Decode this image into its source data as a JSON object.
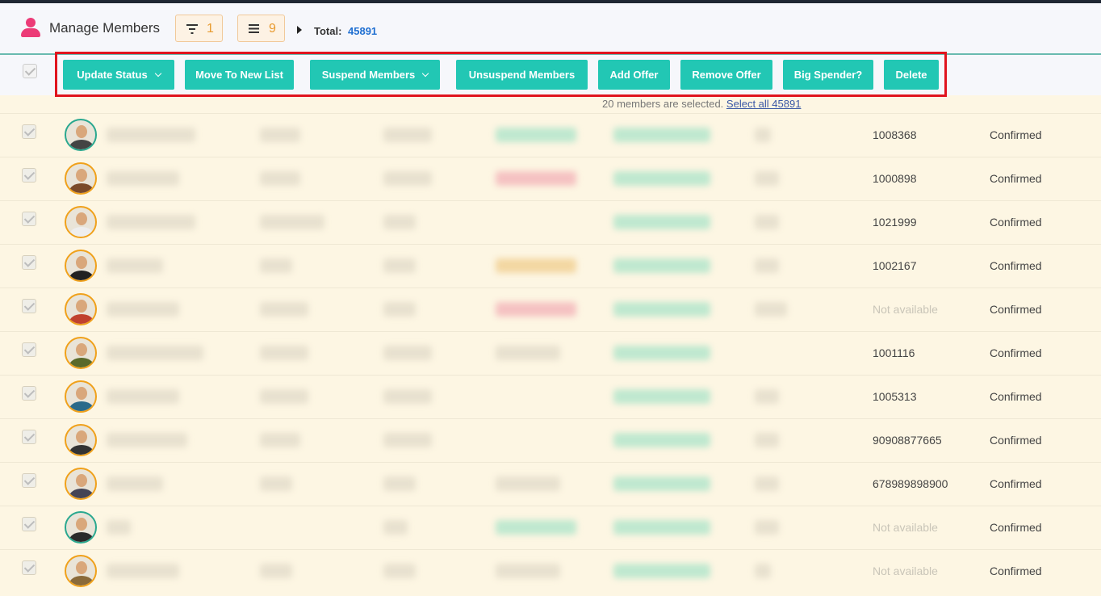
{
  "header": {
    "title": "Manage Members",
    "filter_count": "1",
    "list_count": "9",
    "total_label": "Total:",
    "total_value": "45891"
  },
  "actions": {
    "update_status": "Update Status",
    "move_to_new_list": "Move To New List",
    "suspend_members": "Suspend Members",
    "unsuspend_members": "Unsuspend Members",
    "add_offer": "Add Offer",
    "remove_offer": "Remove Offer",
    "big_spender": "Big Spender?",
    "delete": "Delete"
  },
  "selection": {
    "note": "20 members are selected.",
    "select_all": "Select all 45891"
  },
  "rows": [
    {
      "id": "1008368",
      "status": "Confirmed"
    },
    {
      "id": "1000898",
      "status": "Confirmed"
    },
    {
      "id": "1021999",
      "status": "Confirmed"
    },
    {
      "id": "1002167",
      "status": "Confirmed"
    },
    {
      "id": "Not available",
      "status": "Confirmed"
    },
    {
      "id": "1001116",
      "status": "Confirmed"
    },
    {
      "id": "1005313",
      "status": "Confirmed"
    },
    {
      "id": "90908877665",
      "status": "Confirmed"
    },
    {
      "id": "678989898900",
      "status": "Confirmed"
    },
    {
      "id": "Not available",
      "status": "Confirmed"
    },
    {
      "id": "Not available",
      "status": "Confirmed"
    }
  ],
  "colors": {
    "accent": "#22c7b4",
    "highlight_box": "#e0141e",
    "brand_icon": "#ec3b77",
    "total_value": "#1f6fd1"
  }
}
